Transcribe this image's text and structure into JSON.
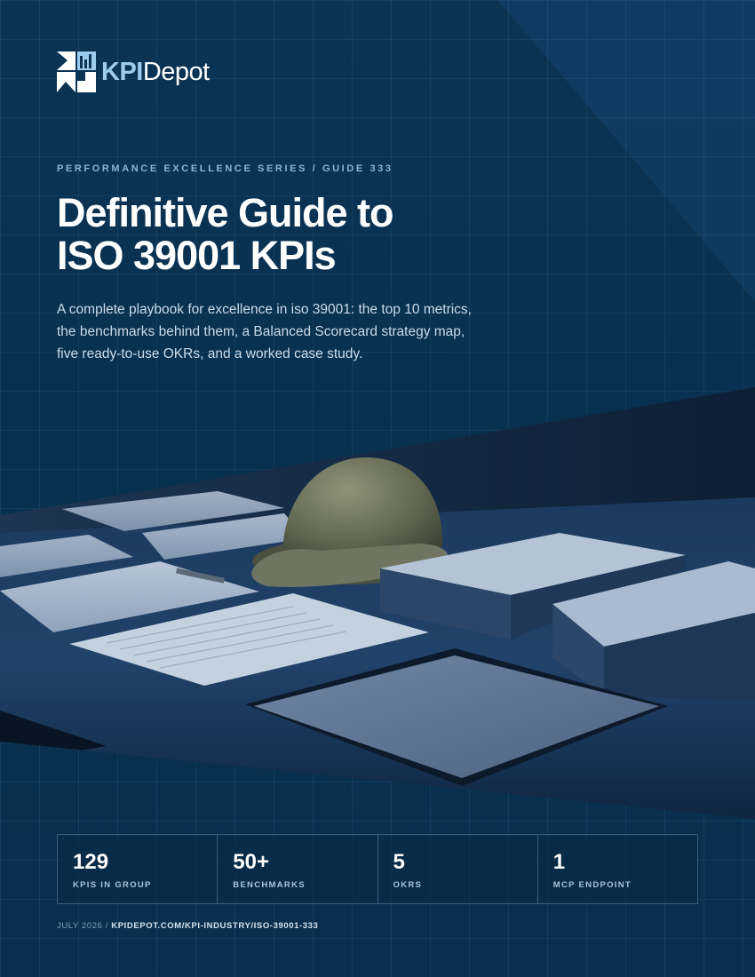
{
  "brand": {
    "name_part1": "KPI",
    "name_part2": "Depot"
  },
  "series_label": "PERFORMANCE EXCELLENCE SERIES / GUIDE 333",
  "title": {
    "line1": "Definitive Guide to",
    "line2": "ISO 39001 KPIs"
  },
  "subtitle": "A complete playbook for excellence in iso 39001: the top 10 metrics, the benchmarks behind them, a Balanced Scorecard strategy map, five ready-to-use OKRs, and a worked case study.",
  "stats": [
    {
      "value": "129",
      "label": "KPIS IN GROUP"
    },
    {
      "value": "50+",
      "label": "BENCHMARKS"
    },
    {
      "value": "5",
      "label": "OKRS"
    },
    {
      "value": "1",
      "label": "MCP ENDPOINT"
    }
  ],
  "footer": {
    "date": "JULY 2026",
    "separator": " / ",
    "url": "KPIDEPOT.COM/KPI-INDUSTRY/ISO-39001-333"
  },
  "colors": {
    "background": "#0b3354",
    "accent": "#9ccbf0",
    "text": "#ffffff"
  },
  "hero_image": {
    "icon": "hard-hat-documents-tablet-photo"
  }
}
